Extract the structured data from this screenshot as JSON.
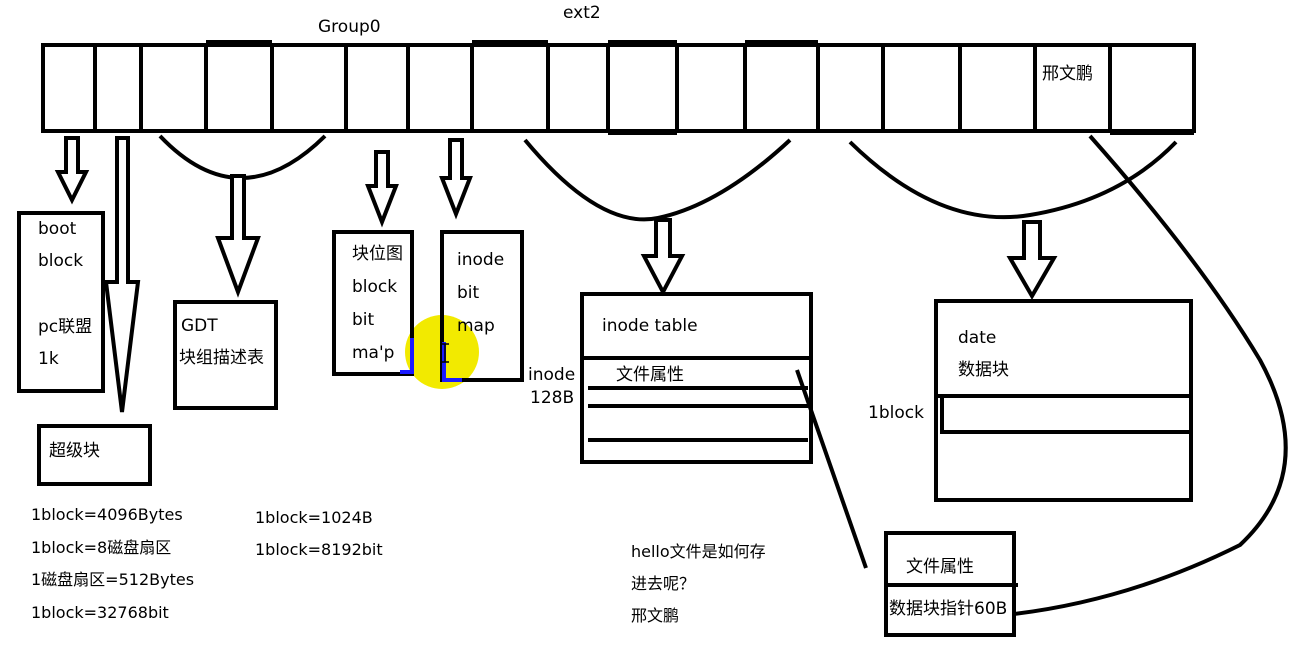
{
  "title": "ext2",
  "group_label": "Group0",
  "strip_label": "邢文鹏",
  "boot_block": [
    "boot",
    "block",
    "",
    "pc联盟",
    "1k"
  ],
  "super_block": "超级块",
  "gdt": [
    "GDT",
    "块组描述表"
  ],
  "block_bitmap": [
    "块位图",
    "block",
    "bit",
    "ma'p"
  ],
  "inode_bitmap": [
    "inode",
    "bit",
    "map"
  ],
  "inode_table": {
    "title": "inode table",
    "row_label": "文件属性",
    "side_label": [
      "inode",
      "128B"
    ]
  },
  "data_block": {
    "title": "date",
    "subtitle": "数据块",
    "row_label": "1block"
  },
  "file_attr_box": [
    "文件属性",
    "数据块指针60B"
  ],
  "notes_left": [
    "1block=4096Bytes",
    "1block=8磁盘扇区",
    "1磁盘扇区=512Bytes",
    "1block=32768bit"
  ],
  "notes_mid": [
    "1block=1024B",
    "1block=8192bit"
  ],
  "notes_question": [
    "hello文件是如何存",
    "进去呢？",
    "邢文鹏"
  ],
  "colors": {
    "highlight": "#f2ea00",
    "cursor_bracket": "#1a1aff",
    "ink": "#000000"
  }
}
